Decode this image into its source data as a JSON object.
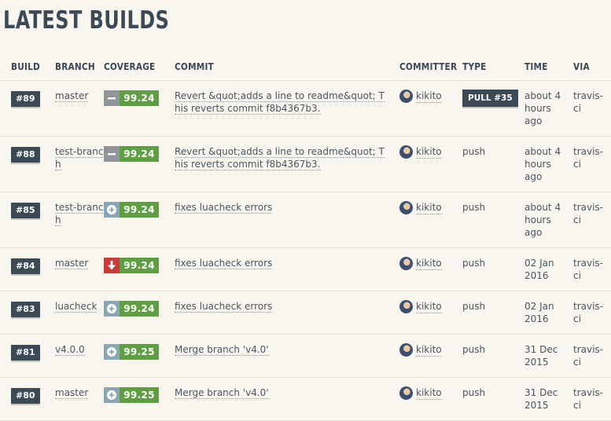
{
  "page": {
    "title": "LATEST BUILDS"
  },
  "columns": {
    "build": "BUILD",
    "branch": "BRANCH",
    "coverage": "COVERAGE",
    "commit": "COMMIT",
    "committer": "COMMITTER",
    "type": "TYPE",
    "time": "TIME",
    "via": "VIA"
  },
  "colors": {
    "header": "#3c4a56",
    "coverage_green": "#5f9e43",
    "coverage_down": "#c73c3b",
    "coverage_up": "#8aa5b3",
    "coverage_same": "#8f9598"
  },
  "builds": [
    {
      "build": "#89",
      "branch": "master",
      "trend": "same",
      "coverage": "99.24",
      "commit": "Revert &quot;adds a line to readme&quot; This reverts commit f8b4367b3.",
      "committer": "kikito",
      "type": "PULL #35",
      "type_is_badge": true,
      "time": "about 4 hours ago",
      "via": "travis-ci"
    },
    {
      "build": "#88",
      "branch": "test-branch",
      "trend": "same",
      "coverage": "99.24",
      "commit": "Revert &quot;adds a line to readme&quot; This reverts commit f8b4367b3.",
      "committer": "kikito",
      "type": "push",
      "type_is_badge": false,
      "time": "about 4 hours ago",
      "via": "travis-ci"
    },
    {
      "build": "#85",
      "branch": "test-branch",
      "trend": "up",
      "coverage": "99.24",
      "commit": "fixes luacheck errors",
      "committer": "kikito",
      "type": "push",
      "type_is_badge": false,
      "time": "about 4 hours ago",
      "via": "travis-ci"
    },
    {
      "build": "#84",
      "branch": "master",
      "trend": "down",
      "coverage": "99.24",
      "commit": "fixes luacheck errors",
      "committer": "kikito",
      "type": "push",
      "type_is_badge": false,
      "time": "02 Jan 2016",
      "via": "travis-ci"
    },
    {
      "build": "#83",
      "branch": "luacheck",
      "trend": "up",
      "coverage": "99.24",
      "commit": "fixes luacheck errors",
      "committer": "kikito",
      "type": "push",
      "type_is_badge": false,
      "time": "02 Jan 2016",
      "via": "travis-ci"
    },
    {
      "build": "#81",
      "branch": "v4.0.0",
      "trend": "up",
      "coverage": "99.25",
      "commit": "Merge branch 'v4.0'",
      "committer": "kikito",
      "type": "push",
      "type_is_badge": false,
      "time": "31 Dec 2015",
      "via": "travis-ci"
    },
    {
      "build": "#80",
      "branch": "master",
      "trend": "up",
      "coverage": "99.25",
      "commit": "Merge branch 'v4.0'",
      "committer": "kikito",
      "type": "push",
      "type_is_badge": false,
      "time": "31 Dec 2015",
      "via": "travis-ci"
    }
  ]
}
